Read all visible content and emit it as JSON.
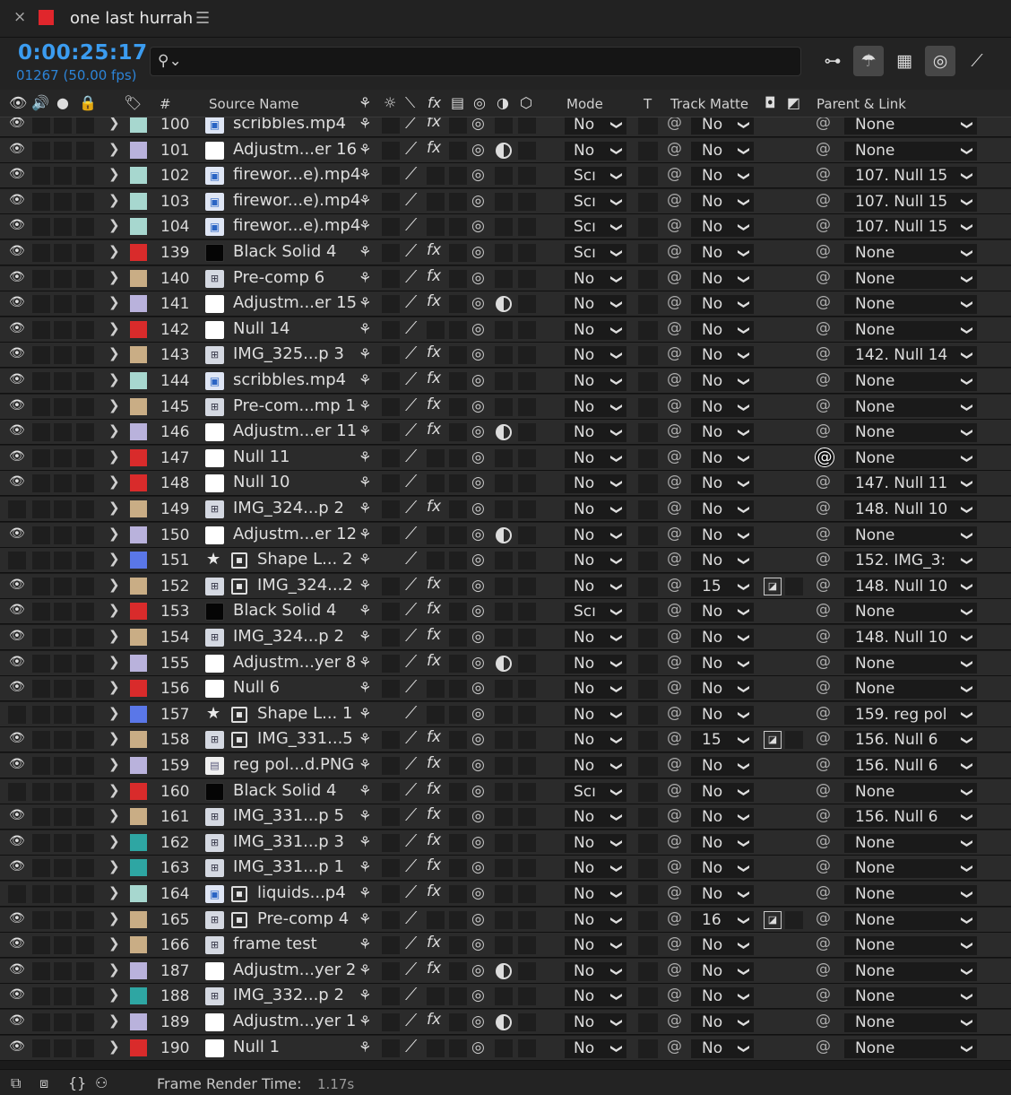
{
  "tab": {
    "close": "×",
    "title": "one last hurrah",
    "menu": "☰",
    "swatch": "#e0262c"
  },
  "toolbar": {
    "timecode": "0:00:25:17",
    "fps": "01267 (50.00 fps)",
    "search_placeholder": ""
  },
  "headers": {
    "hash": "#",
    "source": "Source Name",
    "mode": "Mode",
    "t": "T",
    "track_matte": "Track Matte",
    "parent": "Parent & Link"
  },
  "labels": {
    "red": "#d92b2b",
    "lavender": "#b9b2dc",
    "aqua": "#a7d7cf",
    "tan": "#c9ad85",
    "blue": "#5a77e8",
    "teal": "#2ea6a3"
  },
  "rows": [
    {
      "num": "100",
      "label": "aqua",
      "icon": "video",
      "name": "scribbles.mp4",
      "fx": true,
      "adj": false,
      "mode": "No",
      "tm": "No",
      "parent": "None"
    },
    {
      "num": "101",
      "label": "lavender",
      "icon": "white",
      "name": "Adjustm...er 16",
      "fx": true,
      "adj": true,
      "mode": "No",
      "tm": "No",
      "parent": "None"
    },
    {
      "num": "102",
      "label": "aqua",
      "icon": "video",
      "name": "firewor...e).mp4",
      "fx": false,
      "adj": false,
      "mode": "Scı",
      "tm": "No",
      "parent": "107. Null 15"
    },
    {
      "num": "103",
      "label": "aqua",
      "icon": "video",
      "name": "firewor...e).mp4",
      "fx": false,
      "adj": false,
      "mode": "Scı",
      "tm": "No",
      "parent": "107. Null 15"
    },
    {
      "num": "104",
      "label": "aqua",
      "icon": "video",
      "name": "firewor...e).mp4",
      "fx": false,
      "adj": false,
      "mode": "Scı",
      "tm": "No",
      "parent": "107. Null 15"
    },
    {
      "num": "139",
      "label": "red",
      "icon": "black",
      "name": "Black Solid 4",
      "fx": true,
      "adj": false,
      "mode": "Scı",
      "tm": "No",
      "parent": "None"
    },
    {
      "num": "140",
      "label": "tan",
      "icon": "comp",
      "name": "Pre-comp 6",
      "fx": true,
      "adj": false,
      "mode": "No",
      "tm": "No",
      "parent": "None"
    },
    {
      "num": "141",
      "label": "lavender",
      "icon": "white",
      "name": "Adjustm...er 15",
      "fx": true,
      "adj": true,
      "mode": "No",
      "tm": "No",
      "parent": "None"
    },
    {
      "num": "142",
      "label": "red",
      "icon": "white",
      "name": "Null 14",
      "fx": false,
      "adj": false,
      "mode": "No",
      "tm": "No",
      "parent": "None"
    },
    {
      "num": "143",
      "label": "tan",
      "icon": "comp",
      "name": "IMG_325...p 3",
      "fx": true,
      "adj": false,
      "mode": "No",
      "tm": "No",
      "parent": "142. Null 14"
    },
    {
      "num": "144",
      "label": "aqua",
      "icon": "video",
      "name": "scribbles.mp4",
      "fx": true,
      "adj": false,
      "mode": "No",
      "tm": "No",
      "parent": "None"
    },
    {
      "num": "145",
      "label": "tan",
      "icon": "comp",
      "name": "Pre-com...mp 1",
      "fx": true,
      "adj": false,
      "mode": "No",
      "tm": "No",
      "parent": "None"
    },
    {
      "num": "146",
      "label": "lavender",
      "icon": "white",
      "name": "Adjustm...er 11",
      "fx": true,
      "adj": true,
      "mode": "No",
      "tm": "No",
      "parent": "None"
    },
    {
      "num": "147",
      "label": "red",
      "icon": "white",
      "name": "Null 11",
      "fx": false,
      "adj": false,
      "mode": "No",
      "tm": "No",
      "parent": "None",
      "pickhl": true
    },
    {
      "num": "148",
      "label": "red",
      "icon": "white",
      "name": "Null 10",
      "fx": false,
      "adj": false,
      "mode": "No",
      "tm": "No",
      "parent": "147. Null 11"
    },
    {
      "num": "149",
      "label": "tan",
      "icon": "comp",
      "name": "IMG_324...p 2",
      "fx": true,
      "adj": false,
      "mode": "No",
      "tm": "No",
      "parent": "148. Null 10",
      "noeye": true
    },
    {
      "num": "150",
      "label": "lavender",
      "icon": "white",
      "name": "Adjustm...er 12",
      "fx": false,
      "adj": true,
      "mode": "No",
      "tm": "No",
      "parent": "None"
    },
    {
      "num": "151",
      "label": "blue",
      "icon": "star",
      "name": "Shape L... 2",
      "fx": false,
      "adj": false,
      "mode": "No",
      "tm": "No",
      "parent": "152. IMG_3:",
      "noeye": true,
      "shape": true
    },
    {
      "num": "152",
      "label": "tan",
      "icon": "comp",
      "name": "IMG_324...2",
      "fx": true,
      "adj": false,
      "mode": "No",
      "tm": "15",
      "parent": "148. Null 10",
      "sub": true,
      "tmbox": true
    },
    {
      "num": "153",
      "label": "red",
      "icon": "black",
      "name": "Black Solid 4",
      "fx": true,
      "adj": false,
      "mode": "Scı",
      "tm": "No",
      "parent": "None"
    },
    {
      "num": "154",
      "label": "tan",
      "icon": "comp",
      "name": "IMG_324...p 2",
      "fx": true,
      "adj": false,
      "mode": "No",
      "tm": "No",
      "parent": "148. Null 10"
    },
    {
      "num": "155",
      "label": "lavender",
      "icon": "white",
      "name": "Adjustm...yer 8",
      "fx": true,
      "adj": true,
      "mode": "No",
      "tm": "No",
      "parent": "None"
    },
    {
      "num": "156",
      "label": "red",
      "icon": "white",
      "name": "Null 6",
      "fx": false,
      "adj": false,
      "mode": "No",
      "tm": "No",
      "parent": "None"
    },
    {
      "num": "157",
      "label": "blue",
      "icon": "star",
      "name": "Shape L... 1",
      "fx": false,
      "adj": false,
      "mode": "No",
      "tm": "No",
      "parent": "159. reg pol",
      "noeye": true,
      "shape": true
    },
    {
      "num": "158",
      "label": "tan",
      "icon": "comp",
      "name": "IMG_331...5",
      "fx": true,
      "adj": false,
      "mode": "No",
      "tm": "15",
      "parent": "156. Null 6",
      "sub": true,
      "tmbox": true
    },
    {
      "num": "159",
      "label": "lavender",
      "icon": "png",
      "name": "reg pol...d.PNG",
      "fx": true,
      "adj": false,
      "mode": "No",
      "tm": "No",
      "parent": "156. Null 6"
    },
    {
      "num": "160",
      "label": "red",
      "icon": "black",
      "name": "Black Solid 4",
      "fx": true,
      "adj": false,
      "mode": "Scı",
      "tm": "No",
      "parent": "None",
      "noeye": true
    },
    {
      "num": "161",
      "label": "tan",
      "icon": "comp",
      "name": "IMG_331...p 5",
      "fx": true,
      "adj": false,
      "mode": "No",
      "tm": "No",
      "parent": "156. Null 6"
    },
    {
      "num": "162",
      "label": "teal",
      "icon": "comp",
      "name": "IMG_331...p 3",
      "fx": true,
      "adj": false,
      "mode": "No",
      "tm": "No",
      "parent": "None"
    },
    {
      "num": "163",
      "label": "teal",
      "icon": "comp",
      "name": "IMG_331...p 1",
      "fx": true,
      "adj": false,
      "mode": "No",
      "tm": "No",
      "parent": "None"
    },
    {
      "num": "164",
      "label": "aqua",
      "icon": "video",
      "name": "liquids...p4",
      "fx": true,
      "adj": false,
      "mode": "No",
      "tm": "No",
      "parent": "None",
      "noeye": true,
      "sub": true
    },
    {
      "num": "165",
      "label": "tan",
      "icon": "comp",
      "name": "Pre-comp 4",
      "fx": false,
      "adj": false,
      "mode": "No",
      "tm": "16",
      "parent": "None",
      "sub": true,
      "tmbox": true
    },
    {
      "num": "166",
      "label": "tan",
      "icon": "comp",
      "name": "frame test",
      "fx": true,
      "adj": false,
      "mode": "No",
      "tm": "No",
      "parent": "None"
    },
    {
      "num": "187",
      "label": "lavender",
      "icon": "white",
      "name": "Adjustm...yer 2",
      "fx": true,
      "adj": true,
      "mode": "No",
      "tm": "No",
      "parent": "None"
    },
    {
      "num": "188",
      "label": "teal",
      "icon": "comp",
      "name": "IMG_332...p 2",
      "fx": false,
      "adj": false,
      "mode": "No",
      "tm": "No",
      "parent": "None"
    },
    {
      "num": "189",
      "label": "lavender",
      "icon": "white",
      "name": "Adjustm...yer 1",
      "fx": true,
      "adj": true,
      "mode": "No",
      "tm": "No",
      "parent": "None"
    },
    {
      "num": "190",
      "label": "red",
      "icon": "white",
      "name": "Null 1",
      "fx": false,
      "adj": false,
      "mode": "No",
      "tm": "No",
      "parent": "None"
    }
  ],
  "status": {
    "label": "Frame Render Time:",
    "value": "1.17s"
  }
}
